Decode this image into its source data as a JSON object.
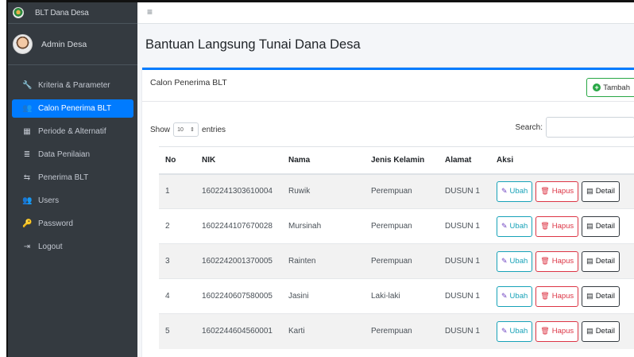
{
  "brand": {
    "title": "BLT Dana Desa"
  },
  "user": {
    "name": "Admin Desa"
  },
  "sidebar": {
    "items": [
      {
        "label": "Kriteria & Parameter",
        "icon": "wrench-icon",
        "glyph": "🔧",
        "active": false
      },
      {
        "label": "Calon Penerima BLT",
        "icon": "users-icon",
        "glyph": "👥",
        "active": true
      },
      {
        "label": "Periode & Alternatif",
        "icon": "calendar-icon",
        "glyph": "▦",
        "active": false
      },
      {
        "label": "Data Penilaian",
        "icon": "database-icon",
        "glyph": "≣",
        "active": false
      },
      {
        "label": "Penerima BLT",
        "icon": "people-arrows-icon",
        "glyph": "⇆",
        "active": false
      },
      {
        "label": "Users",
        "icon": "user-group-icon",
        "glyph": "👥",
        "active": false
      },
      {
        "label": "Password",
        "icon": "key-icon",
        "glyph": "🔑",
        "active": false
      },
      {
        "label": "Logout",
        "icon": "sign-out-icon",
        "glyph": "⇥",
        "active": false
      }
    ]
  },
  "topbar": {
    "menu_glyph": "≡"
  },
  "page": {
    "title": "Bantuan Langsung Tunai Dana Desa"
  },
  "card": {
    "title": "Calon Penerima BLT",
    "add_label": "Tambah",
    "add_glyph": "+"
  },
  "controls": {
    "show_label": "Show",
    "entries_value": "10",
    "entries_label": "entries",
    "search_label": "Search:",
    "search_value": ""
  },
  "table": {
    "headers": [
      "No",
      "NIK",
      "Nama",
      "Jenis Kelamin",
      "Alamat",
      "Aksi"
    ],
    "rows": [
      {
        "no": "1",
        "nik": "1602241303610004",
        "nama": "Ruwik",
        "jk": "Perempuan",
        "alamat": "DUSUN 1"
      },
      {
        "no": "2",
        "nik": "1602244107670028",
        "nama": "Mursinah",
        "jk": "Perempuan",
        "alamat": "DUSUN 1"
      },
      {
        "no": "3",
        "nik": "1602242001370005",
        "nama": "Rainten",
        "jk": "Perempuan",
        "alamat": "DUSUN 1"
      },
      {
        "no": "4",
        "nik": "1602240607580005",
        "nama": "Jasini",
        "jk": "Laki-laki",
        "alamat": "DUSUN 1"
      },
      {
        "no": "5",
        "nik": "1602244604560001",
        "nama": "Karti",
        "jk": "Perempuan",
        "alamat": "DUSUN 1"
      }
    ],
    "actions": {
      "edit": "Ubah",
      "delete": "Hapus",
      "detail": "Detail"
    }
  },
  "colors": {
    "primary": "#007bff",
    "sidebar": "#343a40",
    "success": "#28a745",
    "info": "#17a2b8",
    "danger": "#dc3545"
  }
}
